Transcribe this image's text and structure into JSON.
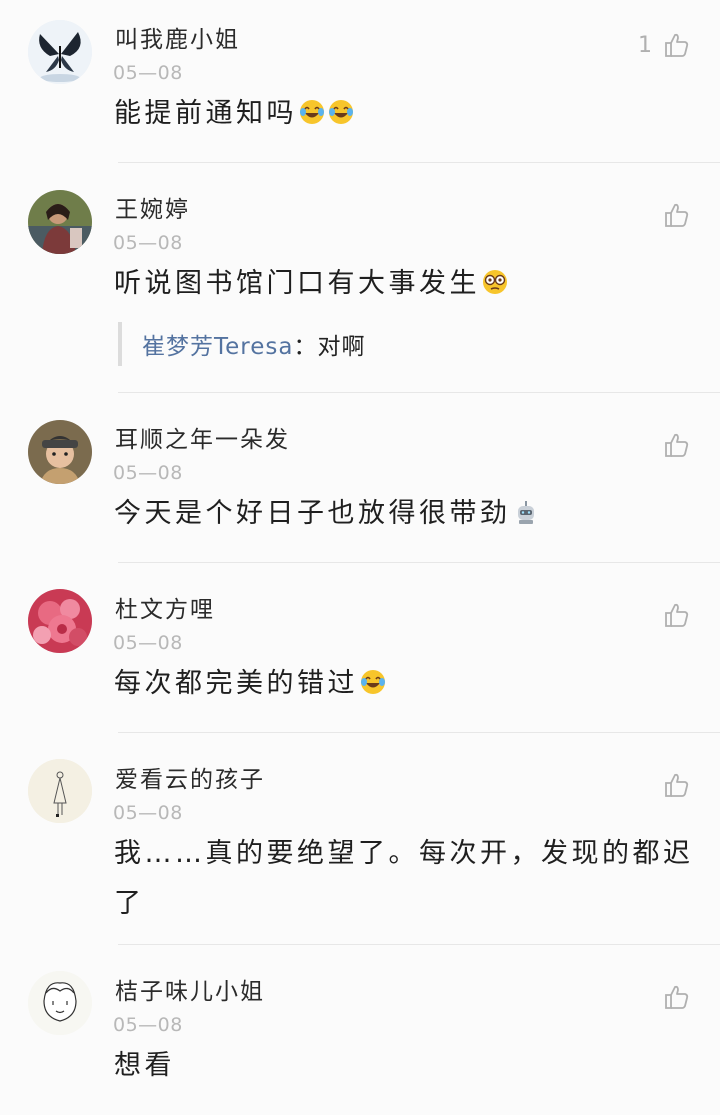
{
  "comments": [
    {
      "author": "叫我鹿小姐",
      "date": "05—08",
      "text": "能提前通知吗",
      "like_count": "1",
      "emoji": [
        "laugh-cry-emoji",
        "laugh-cry-emoji"
      ]
    },
    {
      "author": "王婉婷",
      "date": "05—08",
      "text": "听说图书馆门口有大事发生",
      "like_count": "",
      "emoji": [
        "nervous-emoji"
      ],
      "reply": {
        "author": "崔梦芳Teresa",
        "separator": "：",
        "text": "对啊"
      }
    },
    {
      "author": "耳顺之年一朵发",
      "date": "05—08",
      "text": "今天是个好日子也放得很带劲",
      "like_count": "",
      "emoji": [
        "robot-emoji"
      ]
    },
    {
      "author": "杜文方哩",
      "date": "05—08",
      "text": "每次都完美的错过",
      "like_count": "",
      "emoji": [
        "laugh-cry-emoji"
      ]
    },
    {
      "author": "爱看云的孩子",
      "date": "05—08",
      "text": "我……真的要绝望了。每次开，发现的都迟了",
      "like_count": "",
      "emoji": []
    },
    {
      "author": "桔子味儿小姐",
      "date": "05—08",
      "text": "想看",
      "like_count": "",
      "emoji": []
    }
  ],
  "colors": {
    "background": "#fbfbfb",
    "name": "#2b2b2b",
    "date": "#b8b8b8",
    "reply_name": "#5473a0",
    "like_icon": "#b0b0b0",
    "divider": "#e7e7e7"
  }
}
